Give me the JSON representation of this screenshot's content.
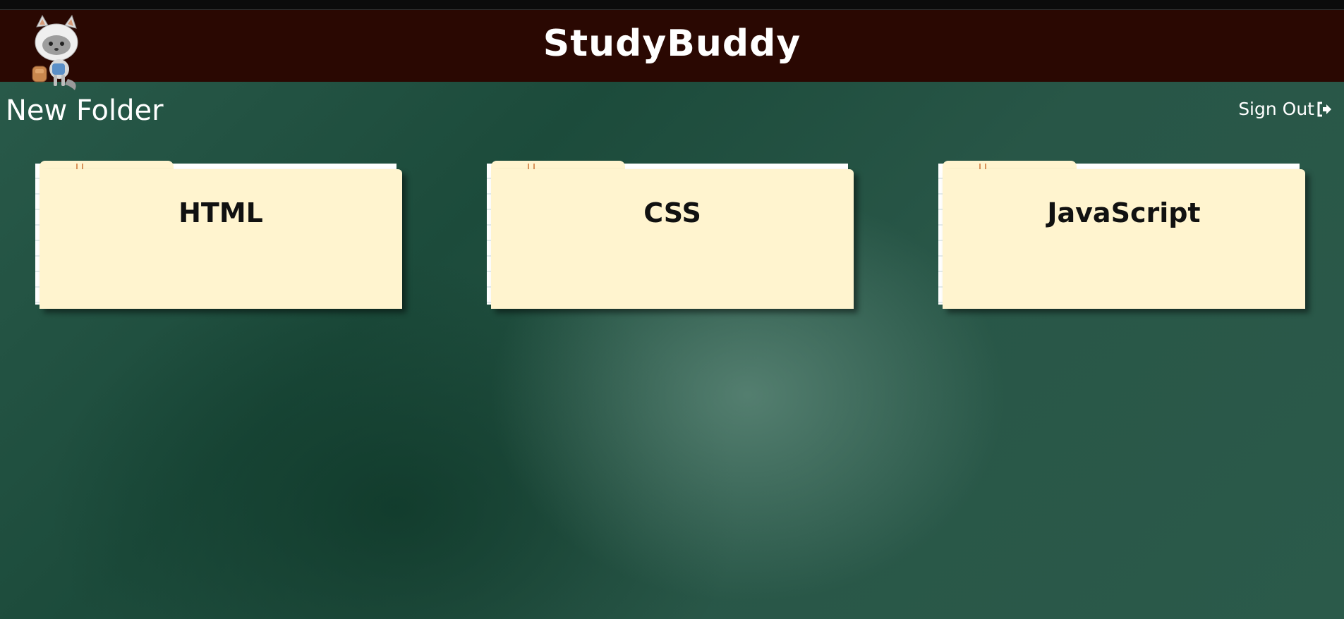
{
  "header": {
    "title": "StudyBuddy",
    "logo_icon": "raccoon-mascot-icon"
  },
  "toolbar": {
    "new_folder_label": "New Folder",
    "sign_out_label": "Sign Out",
    "sign_out_icon": "sign-out-icon"
  },
  "folders": [
    {
      "label": "HTML"
    },
    {
      "label": "CSS"
    },
    {
      "label": "JavaScript"
    }
  ],
  "colors": {
    "header_bg": "#2a0802",
    "board_bg": "#1c4b3b",
    "folder_bg": "#fff4cf",
    "tab_mark": "#d9925a"
  }
}
